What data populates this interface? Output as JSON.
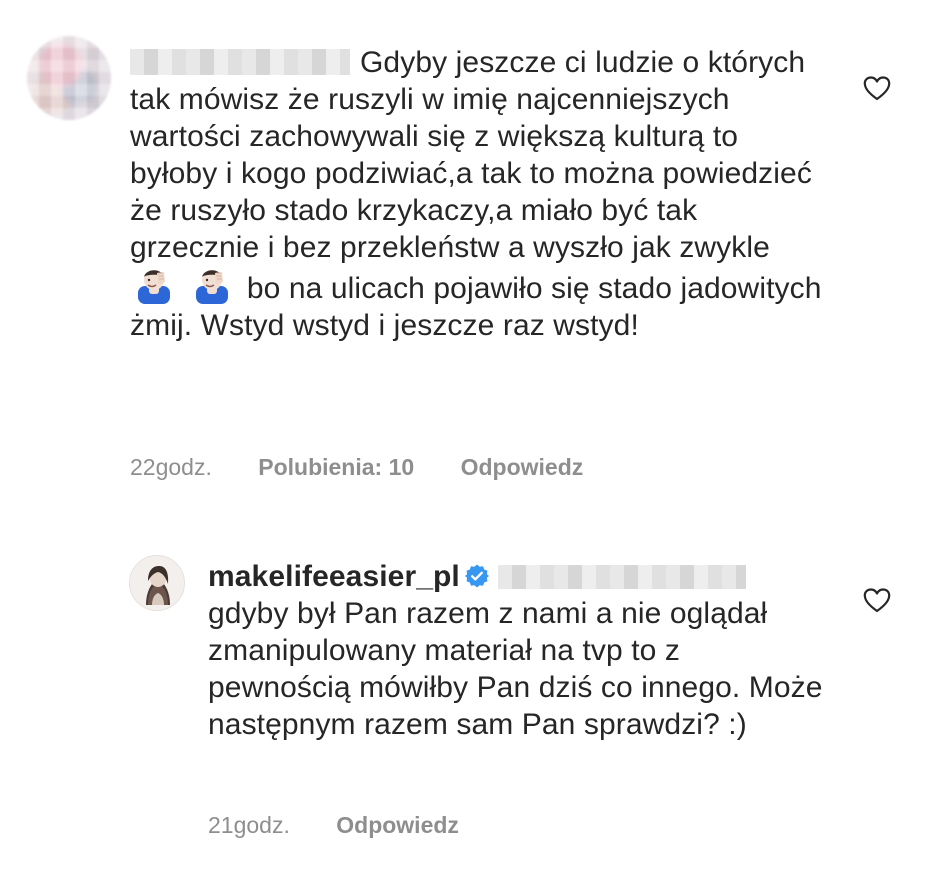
{
  "comments": [
    {
      "username_hidden": true,
      "text_line_1": "Gdyby jeszcze ci ludzie o",
      "text_rest": "których tak mówisz że ruszyli w imię najcenniejszych wartości zachowywali się z większą kulturą to byłoby i kogo podziwiać,a tak to można powiedzieć że ruszyło stado krzykaczy,a miało być tak grzecznie i bez przekleństw a wyszło jak zwykle",
      "text_after_emoji": "bo na ulicach pojawiło się stado jadowitych żmij. Wstyd wstyd i jeszcze raz wstyd!",
      "emojis": [
        "facepalm-emoji",
        "facepalm-emoji"
      ],
      "time": "22godz.",
      "likes": "Polubienia: 10",
      "reply_label": "Odpowiedz",
      "icon": "heart-icon"
    },
    {
      "username": "makelifeeasier_pl",
      "verified": true,
      "text": "gdyby był Pan razem z nami a nie oglądał zmanipulowany materiał na tvp to z pewnością mówiłby Pan dziś co innego. Może następnym razem sam Pan sprawdzi? :)",
      "time": "21godz.",
      "reply_label": "Odpowiedz",
      "icon": "heart-icon"
    }
  ],
  "colors": {
    "text": "#262626",
    "secondary": "#8e8e8e",
    "verified": "#3897f0"
  }
}
